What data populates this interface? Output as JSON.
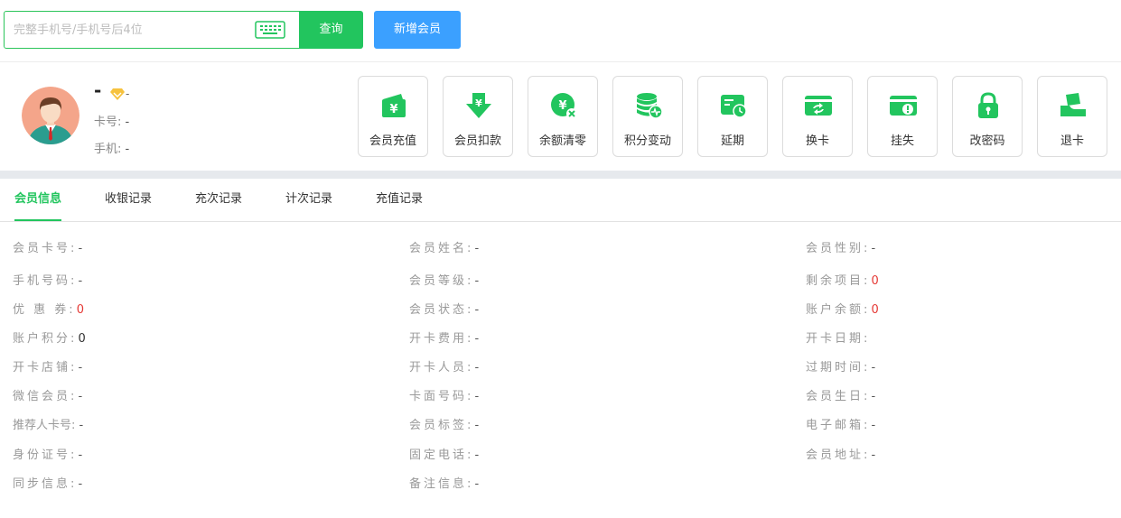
{
  "search": {
    "placeholder": "完整手机号/手机号后4位",
    "query_label": "查询",
    "add_member_label": "新增会员"
  },
  "member": {
    "name": "-",
    "vip_level": "-",
    "card_label": "卡号:",
    "card_value": "-",
    "phone_label": "手机:",
    "phone_value": "-"
  },
  "actions": [
    {
      "label": "会员充值",
      "icon": "wallet-yuan-icon"
    },
    {
      "label": "会员扣款",
      "icon": "yuan-down-arrow-icon"
    },
    {
      "label": "余额清零",
      "icon": "yuan-clear-icon"
    },
    {
      "label": "积分变动",
      "icon": "points-coins-icon"
    },
    {
      "label": "延期",
      "icon": "card-clock-icon"
    },
    {
      "label": "换卡",
      "icon": "card-swap-icon"
    },
    {
      "label": "挂失",
      "icon": "card-alert-icon"
    },
    {
      "label": "改密码",
      "icon": "lock-icon"
    },
    {
      "label": "退卡",
      "icon": "card-return-icon"
    }
  ],
  "tabs": [
    {
      "label": "会员信息",
      "active": true
    },
    {
      "label": "收银记录",
      "active": false
    },
    {
      "label": "充次记录",
      "active": false
    },
    {
      "label": "计次记录",
      "active": false
    },
    {
      "label": "充值记录",
      "active": false
    }
  ],
  "info_rows": [
    [
      {
        "label": "会员卡号",
        "value": "-"
      },
      {
        "label": "会员姓名",
        "value": "-"
      },
      {
        "label": "会员性别",
        "value": "-"
      }
    ],
    [
      {
        "label": "手机号码",
        "value": "-"
      },
      {
        "label": "会员等级",
        "value": "-"
      },
      {
        "label": "剩余项目",
        "value": "0",
        "style": "red"
      }
    ],
    [
      {
        "label": "优 惠 券",
        "value": "0",
        "style": "red"
      },
      {
        "label": "会员状态",
        "value": "-"
      },
      {
        "label": "账户余额",
        "value": "0",
        "style": "red"
      }
    ],
    [
      {
        "label": "账户积分",
        "value": "0",
        "style": "dark"
      },
      {
        "label": "开卡费用",
        "value": "-"
      },
      {
        "label": "开卡日期",
        "value": ""
      }
    ],
    [
      {
        "label": "开卡店铺",
        "value": "-"
      },
      {
        "label": "开卡人员",
        "value": "-"
      },
      {
        "label": "过期时间",
        "value": "-"
      }
    ],
    [
      {
        "label": "微信会员",
        "value": "-"
      },
      {
        "label": "卡面号码",
        "value": "-"
      },
      {
        "label": "会员生日",
        "value": "-"
      }
    ],
    [
      {
        "label": "推荐人卡号",
        "value": "-"
      },
      {
        "label": "会员标签",
        "value": "-"
      },
      {
        "label": "电子邮箱",
        "value": "-"
      }
    ],
    [
      {
        "label": "身份证号",
        "value": "-"
      },
      {
        "label": "固定电话",
        "value": "-"
      },
      {
        "label": "会员地址",
        "value": "-"
      }
    ],
    [
      {
        "label": "同步信息",
        "value": "-"
      },
      {
        "label": "备注信息",
        "value": "-"
      }
    ]
  ],
  "colors": {
    "primary_green": "#22c55e",
    "primary_blue": "#3ba0ff",
    "highlight_red": "#e53935"
  }
}
